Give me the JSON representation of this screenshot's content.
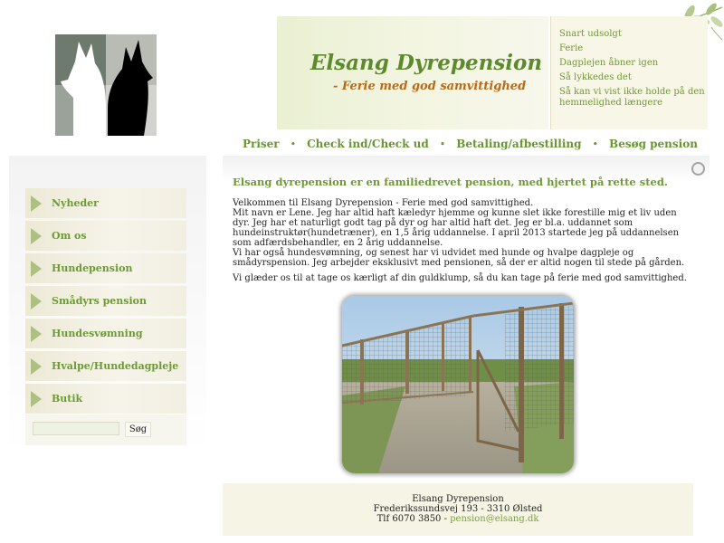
{
  "site": {
    "title": "Elsang Dyrepension",
    "subtitle": "- Ferie med god samvittighed"
  },
  "news": [
    "Snart udsolgt",
    "Ferie",
    "Dagplejen åbner igen",
    "Så lykkedes det",
    "Så kan vi vist ikke holde på den hemmelighed længere"
  ],
  "topnav": [
    "Priser",
    "Check ind/Check ud",
    "Betaling/afbestilling",
    "Besøg pension"
  ],
  "sidebar": {
    "items": [
      "Nyheder",
      "Om os",
      "Hundepension",
      "Smådyrs pension",
      "Hundesvømning",
      "Hvalpe/Hundedagpleje",
      "Butik"
    ],
    "search_placeholder": "",
    "search_button": "Søg"
  },
  "main": {
    "heading": "Elsang dyrepension er en familiedrevet pension, med hjertet på rette sted.",
    "paragraphs": [
      "Velkommen til Elsang Dyrepension - Ferie med god samvittighed.",
      "Mit navn er Lene. Jeg har altid haft kæledyr hjemme og kunne slet ikke forestille mig et liv uden dyr. Jeg har et naturligt godt tag på dyr og har altid haft det. Jeg er bl.a. uddannet som hundeinstruktør(hundetræner), en 1,5 årig uddannelse. I april 2013 startede jeg på uddannelsen som adfærdsbehandler, en 2 årig uddannelse.",
      "Vi har også hundesvømning, og senest har vi udvidet med hunde og hvalpe dagpleje og smådyrspension. Jeg arbejder eksklusivt med pensionen, så der er altid nogen til stede på gården.",
      "Vi glæder os til at tage os kærligt af din guldklump, så du kan tage på ferie med god samvittighed."
    ]
  },
  "footer": {
    "name": "Elsang Dyrepension",
    "address": "Frederikssundsvej 193 - 3310 Ølsted",
    "phone_prefix": "Tlf 6070 3850 - ",
    "email": "pension@elsang.dk"
  },
  "colors": {
    "accent_green": "#6a9533",
    "subtitle_orange": "#b86a1a",
    "panel_cream": "#f6f4e4"
  }
}
